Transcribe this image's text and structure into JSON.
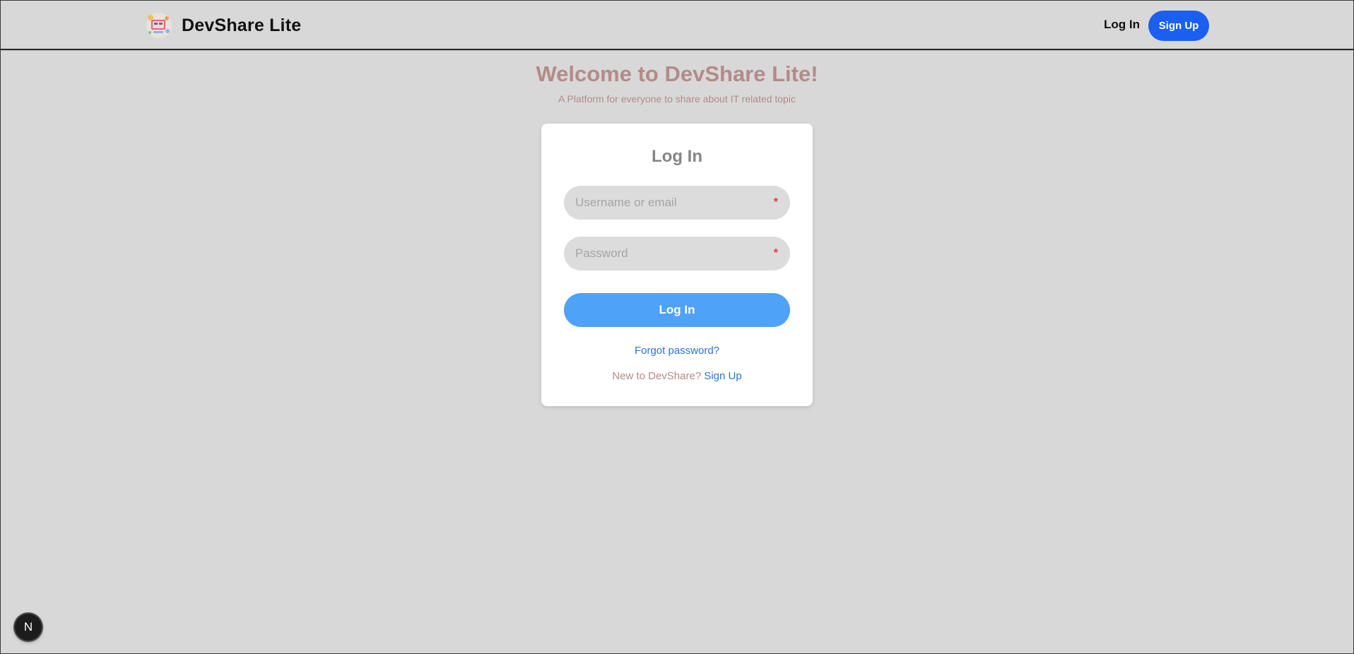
{
  "nav": {
    "brand_name": "DevShare Lite",
    "login_label": "Log In",
    "signup_label": "Sign Up"
  },
  "hero": {
    "title": "Welcome to DevShare Lite!",
    "subtitle": "A Platform for everyone to share about IT related topic"
  },
  "login_card": {
    "title": "Log In",
    "username_placeholder": "Username or email",
    "password_placeholder": "Password",
    "required_marker": "*",
    "submit_label": "Log In",
    "forgot_label": "Forgot password?",
    "signup_prompt": "New to DevShare?",
    "signup_link": "Sign Up"
  },
  "badge": {
    "letter": "N"
  },
  "colors": {
    "background": "#d9d8d9",
    "brand_blue": "#1a5ff0",
    "submit_blue": "#4ea2f8",
    "link_blue": "#2b72d8",
    "heading_rose": "#b48a87",
    "required_red": "#e53935"
  },
  "icons": {
    "brand_logo": "devshare-logo-icon"
  }
}
